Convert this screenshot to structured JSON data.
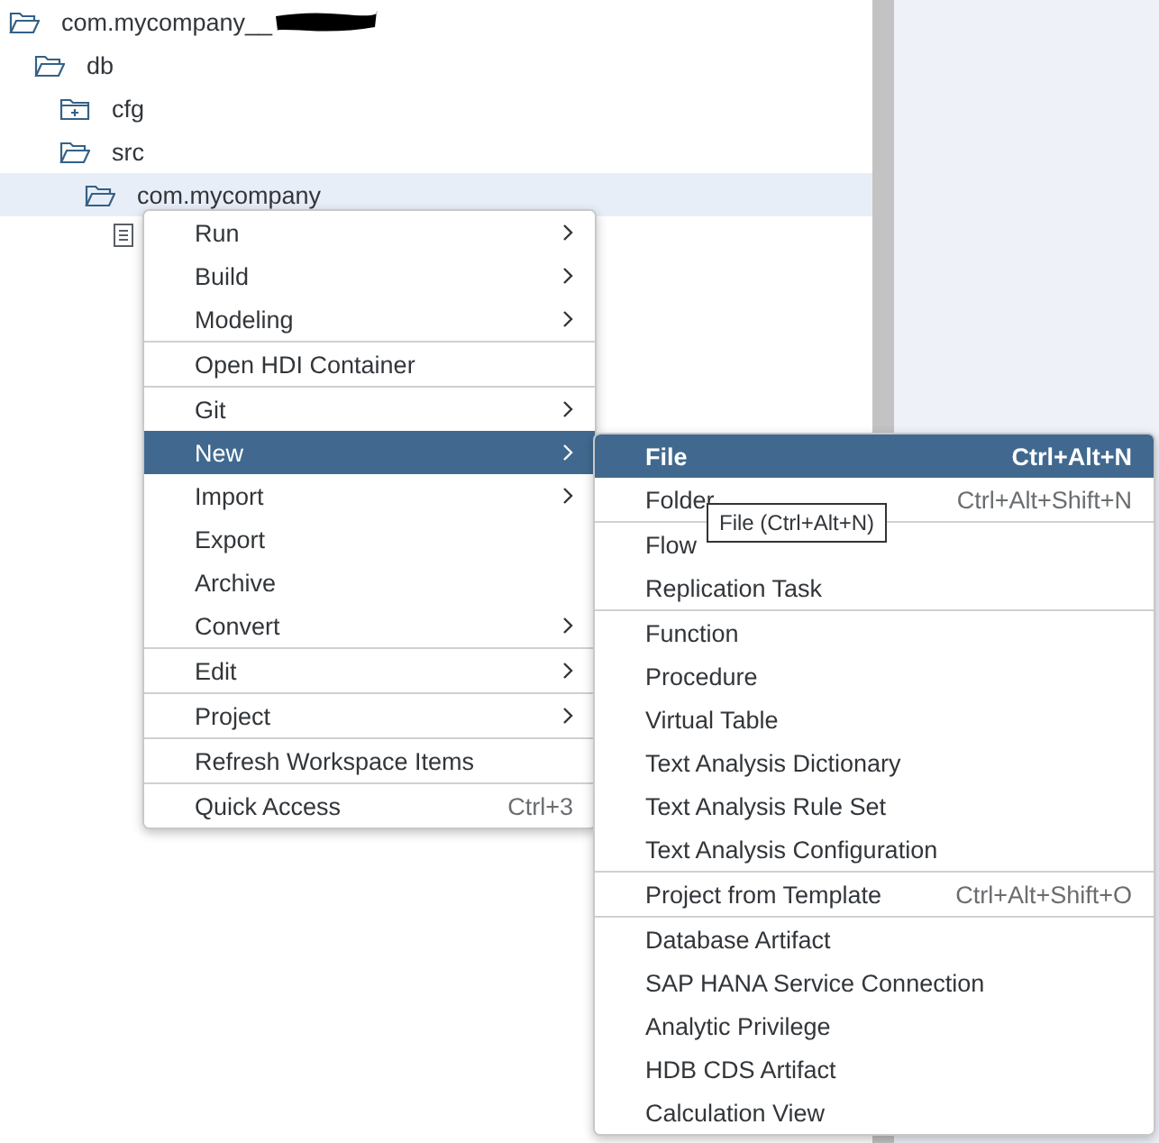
{
  "tree": [
    {
      "label": "com.mycompany__",
      "kind": "folder",
      "expanded": true,
      "redacted": true,
      "selected": false,
      "children": [
        {
          "label": "db",
          "kind": "folder",
          "expanded": true,
          "selected": false,
          "children": [
            {
              "label": "cfg",
              "kind": "folder",
              "expanded": false,
              "selected": false
            },
            {
              "label": "src",
              "kind": "folder",
              "expanded": true,
              "selected": false,
              "children": [
                {
                  "label": "com.mycompany",
                  "kind": "folder",
                  "expanded": true,
                  "selected": true,
                  "children": [
                    {
                      "kind": "file",
                      "selected": false
                    }
                  ]
                }
              ]
            }
          ]
        }
      ]
    }
  ],
  "context_menu": {
    "groups": [
      [
        {
          "label": "Run",
          "submenu": true,
          "selected": false
        },
        {
          "label": "Build",
          "submenu": true,
          "selected": false
        },
        {
          "label": "Modeling",
          "submenu": true,
          "selected": false
        }
      ],
      [
        {
          "label": "Open HDI Container",
          "submenu": false,
          "selected": false
        }
      ],
      [
        {
          "label": "Git",
          "submenu": true,
          "selected": false
        },
        {
          "label": "New",
          "submenu": true,
          "selected": true
        },
        {
          "label": "Import",
          "submenu": true,
          "selected": false
        },
        {
          "label": "Export",
          "submenu": false,
          "selected": false
        },
        {
          "label": "Archive",
          "submenu": false,
          "selected": false
        },
        {
          "label": "Convert",
          "submenu": true,
          "selected": false
        }
      ],
      [
        {
          "label": "Edit",
          "submenu": true,
          "selected": false
        }
      ],
      [
        {
          "label": "Project",
          "submenu": true,
          "selected": false
        }
      ],
      [
        {
          "label": "Refresh Workspace Items",
          "submenu": false,
          "selected": false
        }
      ],
      [
        {
          "label": "Quick Access",
          "shortcut": "Ctrl+3",
          "submenu": false,
          "selected": false
        }
      ]
    ]
  },
  "submenu": {
    "groups": [
      [
        {
          "label": "File",
          "shortcut": "Ctrl+Alt+N",
          "selected": true
        },
        {
          "label": "Folder",
          "shortcut": "Ctrl+Alt+Shift+N",
          "selected": false
        }
      ],
      [
        {
          "label": "Flow",
          "selected": false
        },
        {
          "label": "Replication Task",
          "selected": false
        }
      ],
      [
        {
          "label": "Function",
          "selected": false
        },
        {
          "label": "Procedure",
          "selected": false
        },
        {
          "label": "Virtual Table",
          "selected": false
        },
        {
          "label": "Text Analysis Dictionary",
          "selected": false
        },
        {
          "label": "Text Analysis Rule Set",
          "selected": false
        },
        {
          "label": "Text Analysis Configuration",
          "selected": false
        }
      ],
      [
        {
          "label": "Project from Template",
          "shortcut": "Ctrl+Alt+Shift+O",
          "selected": false
        }
      ],
      [
        {
          "label": "Database Artifact",
          "selected": false
        },
        {
          "label": "SAP HANA Service Connection",
          "selected": false
        },
        {
          "label": "Analytic Privilege",
          "selected": false
        },
        {
          "label": "HDB CDS Artifact",
          "selected": false
        },
        {
          "label": "Calculation View",
          "selected": false
        }
      ]
    ]
  },
  "tooltip": "File (Ctrl+Alt+N)"
}
